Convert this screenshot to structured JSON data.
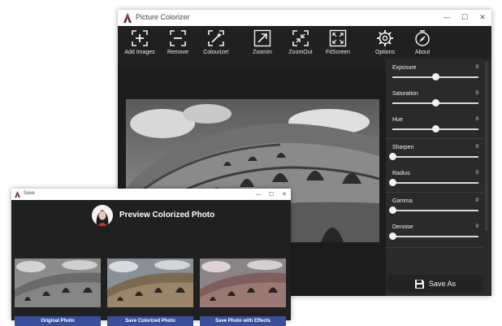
{
  "main_window": {
    "title": "Picture Colorizer",
    "controls": {
      "minimize": "—",
      "maximize": "☐",
      "close": "✕"
    },
    "toolbar": [
      {
        "id": "add",
        "label": "Add Images",
        "icon": "add-images-icon"
      },
      {
        "id": "remove",
        "label": "Remove",
        "icon": "remove-icon"
      },
      {
        "id": "colourize",
        "label": "Colourize!",
        "icon": "colourize-icon"
      },
      {
        "id": "zoomin",
        "label": "ZoomIn",
        "icon": "zoom-in-icon"
      },
      {
        "id": "zoomout",
        "label": "ZoomOut",
        "icon": "zoom-out-icon"
      },
      {
        "id": "fitscreen",
        "label": "FitScreen",
        "icon": "fit-screen-icon"
      },
      {
        "id": "options",
        "label": "Options",
        "icon": "gear-icon"
      },
      {
        "id": "about",
        "label": "About",
        "icon": "compass-icon"
      }
    ],
    "sliders": [
      {
        "name": "Exposure",
        "value": "0",
        "position": 0.5
      },
      {
        "name": "Saturation",
        "value": "0",
        "position": 0.5
      },
      {
        "name": "Hue",
        "value": "0",
        "position": 0.5
      },
      {
        "name": "Sharpen",
        "value": "0",
        "position": 0.0
      },
      {
        "name": "Radius",
        "value": "0",
        "position": 0.0
      },
      {
        "name": "Gamma",
        "value": "0",
        "position": 0.0
      },
      {
        "name": "Denoise",
        "value": "0",
        "position": 0.0
      }
    ],
    "save_label": "Save As"
  },
  "preview_window": {
    "title": "Save",
    "controls": {
      "minimize": "—",
      "maximize": "☐",
      "close": "✕"
    },
    "heading": "Preview Colorized Photo",
    "cards": [
      {
        "label": "Original Photo",
        "tone": "bw"
      },
      {
        "label": "Save Colorized Photo",
        "tone": "warm"
      },
      {
        "label": "Save Photo with Effects",
        "tone": "rose"
      }
    ]
  },
  "colors": {
    "app_bg": "#202020",
    "sidebar_bg": "#2a2a2a",
    "caption_bar": "#3a4f9b"
  }
}
